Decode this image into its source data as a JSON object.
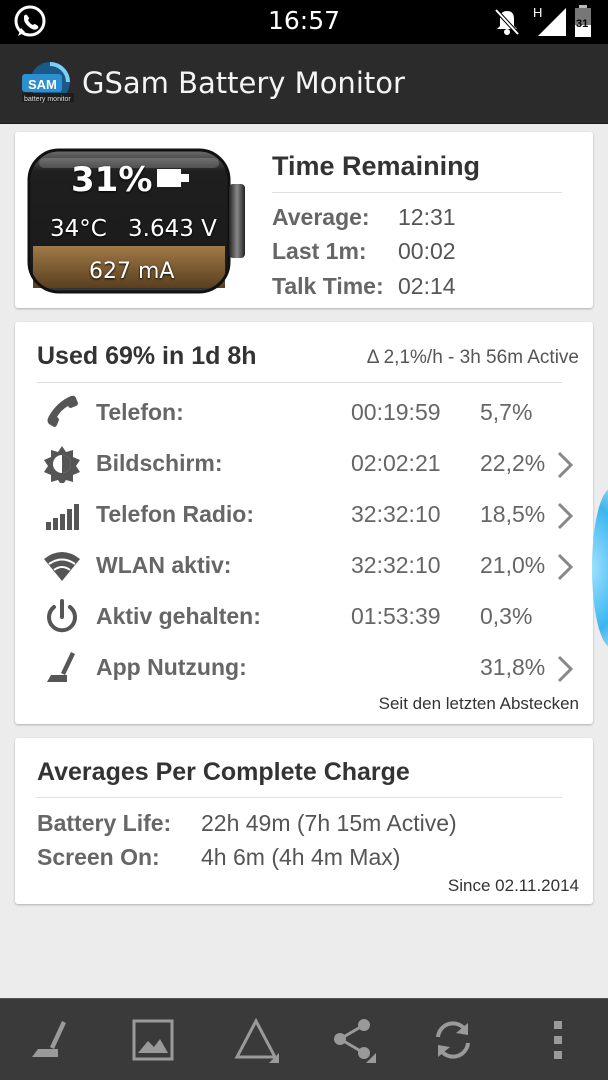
{
  "status_bar": {
    "time": "16:57",
    "network": "H",
    "battery_level": "31"
  },
  "app": {
    "title": "GSam Battery Monitor",
    "logo_text": "SAM",
    "logo_subtext": "battery monitor"
  },
  "battery_card": {
    "percent": "31%",
    "temperature": "34°C",
    "voltage": "3.643 V",
    "current": "627 mA",
    "level": 0.31,
    "time_remaining_title": "Time Remaining",
    "rows": [
      {
        "label": "Average:",
        "value": "12:31"
      },
      {
        "label": "Last 1m:",
        "value": "00:02"
      },
      {
        "label": "Talk Time:",
        "value": "02:14"
      }
    ]
  },
  "usage_card": {
    "title": "Used 69% in 1d 8h",
    "rate": "Δ 2,1%/h - 3h 56m Active",
    "rows": [
      {
        "icon": "phone-icon",
        "label": "Telefon:",
        "duration": "00:19:59",
        "percent": "5,7%",
        "has_detail": false
      },
      {
        "icon": "brightness-icon",
        "label": "Bildschirm:",
        "duration": "02:02:21",
        "percent": "22,2%",
        "has_detail": true
      },
      {
        "icon": "signal-bars-icon",
        "label": "Telefon Radio:",
        "duration": "32:32:10",
        "percent": "18,5%",
        "has_detail": true
      },
      {
        "icon": "wifi-icon",
        "label": "WLAN aktiv:",
        "duration": "32:32:10",
        "percent": "21,0%",
        "has_detail": true
      },
      {
        "icon": "power-icon",
        "label": "Aktiv gehalten:",
        "duration": "01:53:39",
        "percent": "0,3%",
        "has_detail": false
      },
      {
        "icon": "app-usage-icon",
        "label": "App Nutzung:",
        "duration": "",
        "percent": "31,8%",
        "has_detail": true
      }
    ],
    "footer": "Seit den letzten Abstecken"
  },
  "averages_card": {
    "title": "Averages Per Complete Charge",
    "rows": [
      {
        "label": "Battery Life:",
        "value": "22h 49m (7h 15m Active)"
      },
      {
        "label": "Screen On:",
        "value": "4h 6m (4h 4m Max)"
      }
    ],
    "footer": "Since 02.11.2014"
  },
  "bottom_bar": {
    "buttons": [
      "app-usage-icon",
      "picture-icon",
      "triangle-icon",
      "share-icon",
      "refresh-icon",
      "overflow-menu-icon"
    ]
  },
  "colors": {
    "accent": "#3bb6ef",
    "action_bar": "#2b2b2b",
    "battery_fill": "#8a6a3f"
  }
}
